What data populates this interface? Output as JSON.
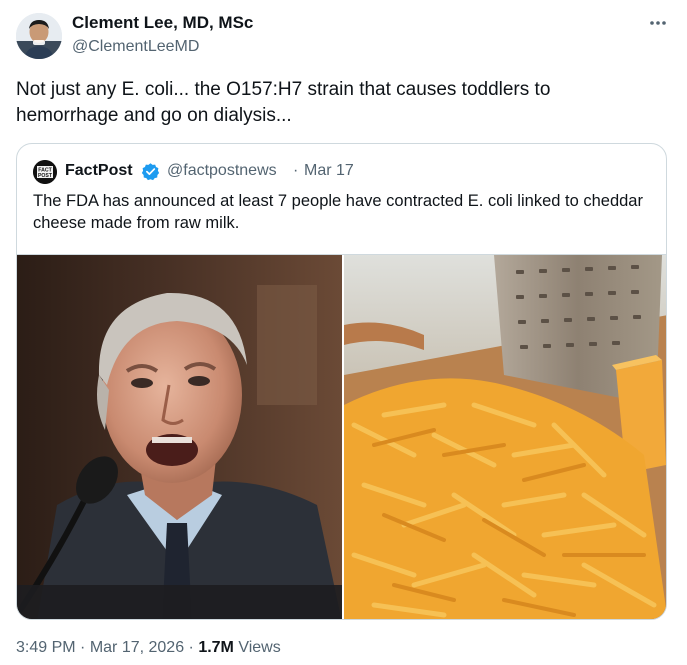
{
  "author": {
    "name": "Clement Lee, MD, MSc",
    "handle": "@ClementLeeMD"
  },
  "more_icon": "more-horizontal-icon",
  "tweet": {
    "text": "Not just any E. coli... the O157:H7 strain that causes toddlers to hemorrhage and go on dialysis..."
  },
  "quote": {
    "avatar_text": "FACT POST",
    "name": "FactPost",
    "handle": "@factpostnews",
    "separator": "·",
    "date": "Mar 17",
    "text": "The FDA has announced at least 7 people have contracted E. coli linked to cheddar cheese made from raw milk.",
    "verified_color": "#1d9bf0"
  },
  "meta": {
    "time": "3:49 PM",
    "sep1": " · ",
    "date": "Mar 17, 2026",
    "sep2": " · ",
    "views_count": "1.7M",
    "views_label": " Views"
  }
}
